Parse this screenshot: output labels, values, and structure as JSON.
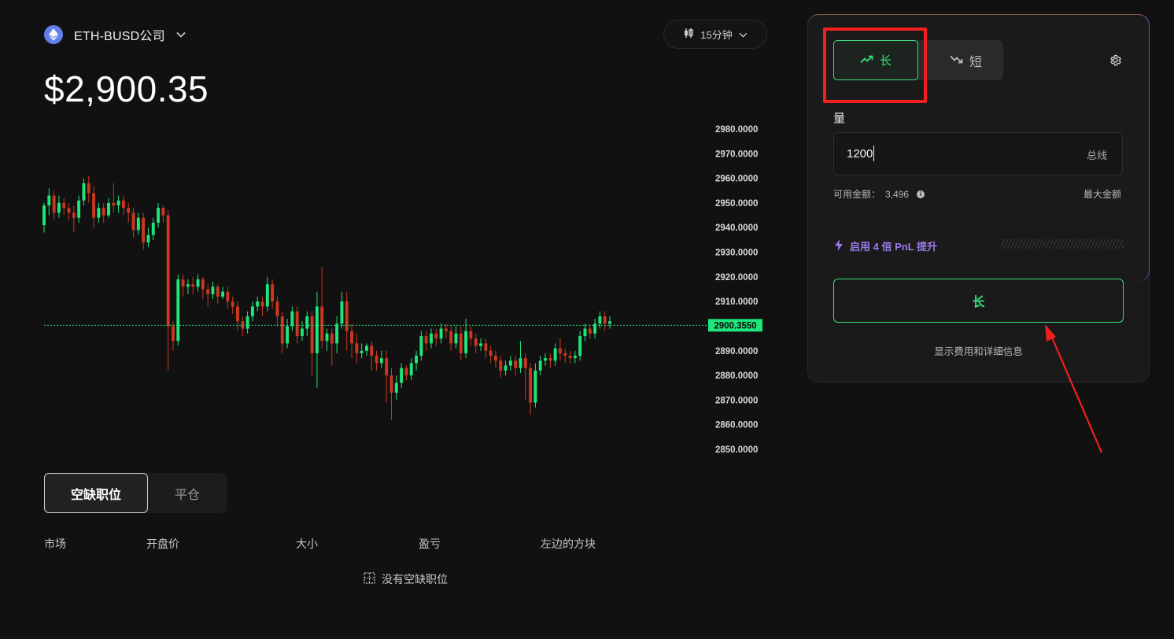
{
  "header": {
    "pair": "ETH-BUSD公司",
    "pair_icon": "ethereum-icon",
    "price": "$2,900.35",
    "interval": "15分钟"
  },
  "chart_data": {
    "type": "candlestick",
    "ylim": [
      2850,
      2980
    ],
    "y_ticks": [
      "2980.0000",
      "2970.0000",
      "2960.0000",
      "2950.0000",
      "2940.0000",
      "2930.0000",
      "2920.0000",
      "2910.0000",
      "2900.0000",
      "2890.0000",
      "2880.0000",
      "2870.0000",
      "2860.0000",
      "2850.0000"
    ],
    "current_price_label": "2900.3550",
    "current_price": 2900.355,
    "colors": {
      "up": "#1fe57a",
      "down": "#c8391f",
      "price_line": "#1fe57a"
    },
    "candles": [
      [
        2941,
        2949,
        2938,
        2950
      ],
      [
        2949,
        2953,
        2945,
        2956
      ],
      [
        2953,
        2946,
        2943,
        2955
      ],
      [
        2946,
        2950,
        2944,
        2953
      ],
      [
        2950,
        2948,
        2945,
        2952
      ],
      [
        2948,
        2946,
        2943,
        2950
      ],
      [
        2946,
        2944,
        2938,
        2949
      ],
      [
        2944,
        2951,
        2942,
        2953
      ],
      [
        2951,
        2958,
        2949,
        2960
      ],
      [
        2958,
        2954,
        2950,
        2961
      ],
      [
        2954,
        2944,
        2940,
        2957
      ],
      [
        2944,
        2948,
        2942,
        2950
      ],
      [
        2948,
        2945,
        2942,
        2950
      ],
      [
        2945,
        2950,
        2944,
        2952
      ],
      [
        2950,
        2949,
        2946,
        2958
      ],
      [
        2949,
        2951,
        2946,
        2953
      ],
      [
        2951,
        2948,
        2945,
        2953
      ],
      [
        2948,
        2946,
        2942,
        2950
      ],
      [
        2946,
        2939,
        2936,
        2948
      ],
      [
        2939,
        2944,
        2937,
        2946
      ],
      [
        2944,
        2934,
        2931,
        2946
      ],
      [
        2934,
        2937,
        2932,
        2940
      ],
      [
        2937,
        2942,
        2935,
        2944
      ],
      [
        2942,
        2948,
        2940,
        2950
      ],
      [
        2948,
        2945,
        2942,
        2949
      ],
      [
        2945,
        2900,
        2882,
        2947
      ],
      [
        2900,
        2894,
        2890,
        2902
      ],
      [
        2894,
        2919,
        2892,
        2921
      ],
      [
        2919,
        2916,
        2912,
        2921
      ],
      [
        2916,
        2917,
        2913,
        2919
      ],
      [
        2917,
        2916,
        2913,
        2920
      ],
      [
        2916,
        2919,
        2914,
        2921
      ],
      [
        2919,
        2915,
        2911,
        2920
      ],
      [
        2915,
        2913,
        2908,
        2917
      ],
      [
        2913,
        2916,
        2911,
        2918
      ],
      [
        2916,
        2912,
        2909,
        2917
      ],
      [
        2912,
        2914,
        2911,
        2916
      ],
      [
        2914,
        2910,
        2907,
        2916
      ],
      [
        2910,
        2908,
        2905,
        2912
      ],
      [
        2908,
        2902,
        2898,
        2910
      ],
      [
        2902,
        2899,
        2896,
        2904
      ],
      [
        2899,
        2904,
        2897,
        2906
      ],
      [
        2904,
        2908,
        2902,
        2910
      ],
      [
        2908,
        2910,
        2906,
        2912
      ],
      [
        2910,
        2908,
        2904,
        2912
      ],
      [
        2908,
        2917,
        2906,
        2920
      ],
      [
        2917,
        2910,
        2907,
        2919
      ],
      [
        2910,
        2904,
        2900,
        2912
      ],
      [
        2904,
        2893,
        2889,
        2906
      ],
      [
        2893,
        2900,
        2891,
        2903
      ],
      [
        2900,
        2906,
        2898,
        2908
      ],
      [
        2906,
        2896,
        2893,
        2908
      ],
      [
        2896,
        2899,
        2894,
        2902
      ],
      [
        2899,
        2904,
        2896,
        2906
      ],
      [
        2904,
        2889,
        2880,
        2906
      ],
      [
        2889,
        2908,
        2875,
        2914
      ],
      [
        2908,
        2894,
        2891,
        2924
      ],
      [
        2894,
        2897,
        2890,
        2899
      ],
      [
        2897,
        2893,
        2884,
        2899
      ],
      [
        2893,
        2901,
        2889,
        2904
      ],
      [
        2901,
        2910,
        2899,
        2914
      ],
      [
        2910,
        2898,
        2890,
        2914
      ],
      [
        2898,
        2893,
        2887,
        2901
      ],
      [
        2893,
        2889,
        2885,
        2897
      ],
      [
        2889,
        2890,
        2887,
        2893
      ],
      [
        2890,
        2892,
        2888,
        2893
      ],
      [
        2892,
        2888,
        2882,
        2894
      ],
      [
        2888,
        2885,
        2882,
        2890
      ],
      [
        2885,
        2887,
        2883,
        2890
      ],
      [
        2887,
        2880,
        2869,
        2890
      ],
      [
        2880,
        2873,
        2862,
        2883
      ],
      [
        2873,
        2877,
        2870,
        2880
      ],
      [
        2877,
        2883,
        2875,
        2885
      ],
      [
        2883,
        2880,
        2878,
        2884
      ],
      [
        2880,
        2885,
        2878,
        2887
      ],
      [
        2885,
        2888,
        2882,
        2890
      ],
      [
        2888,
        2896,
        2886,
        2898
      ],
      [
        2896,
        2893,
        2890,
        2898
      ],
      [
        2893,
        2897,
        2891,
        2899
      ],
      [
        2897,
        2895,
        2892,
        2899
      ],
      [
        2895,
        2899,
        2893,
        2901
      ],
      [
        2899,
        2898,
        2895,
        2901
      ],
      [
        2898,
        2893,
        2890,
        2900
      ],
      [
        2893,
        2897,
        2891,
        2900
      ],
      [
        2897,
        2889,
        2886,
        2900
      ],
      [
        2889,
        2898,
        2887,
        2903
      ],
      [
        2898,
        2895,
        2892,
        2900
      ],
      [
        2895,
        2892,
        2889,
        2897
      ],
      [
        2892,
        2893,
        2890,
        2895
      ],
      [
        2893,
        2890,
        2887,
        2895
      ],
      [
        2890,
        2888,
        2885,
        2892
      ],
      [
        2888,
        2886,
        2883,
        2890
      ],
      [
        2886,
        2882,
        2879,
        2888
      ],
      [
        2882,
        2884,
        2880,
        2886
      ],
      [
        2884,
        2886,
        2882,
        2888
      ],
      [
        2886,
        2883,
        2880,
        2888
      ],
      [
        2883,
        2887,
        2881,
        2894
      ],
      [
        2887,
        2883,
        2870,
        2889
      ],
      [
        2883,
        2869,
        2864,
        2885
      ],
      [
        2869,
        2882,
        2867,
        2885
      ],
      [
        2882,
        2886,
        2880,
        2888
      ],
      [
        2886,
        2887,
        2884,
        2889
      ],
      [
        2887,
        2886,
        2883,
        2889
      ],
      [
        2886,
        2891,
        2884,
        2893
      ],
      [
        2891,
        2889,
        2886,
        2895
      ],
      [
        2889,
        2888,
        2885,
        2891
      ],
      [
        2888,
        2887,
        2885,
        2890
      ],
      [
        2887,
        2888,
        2885,
        2890
      ],
      [
        2888,
        2896,
        2886,
        2898
      ],
      [
        2896,
        2899,
        2894,
        2901
      ],
      [
        2899,
        2897,
        2895,
        2901
      ],
      [
        2897,
        2901,
        2895,
        2903
      ],
      [
        2901,
        2904,
        2899,
        2906
      ],
      [
        2904,
        2901,
        2898,
        2906
      ],
      [
        2901,
        2902,
        2899,
        2904
      ]
    ]
  },
  "positions": {
    "tabs": [
      "空缺职位",
      "平仓"
    ],
    "columns": [
      "市场",
      "开盘价",
      "大小",
      "盈亏",
      "左边的方块"
    ],
    "empty": "没有空缺职位"
  },
  "order_panel": {
    "long_label": "长",
    "short_label": "短",
    "qty_label": "量",
    "qty_value": "1200",
    "qty_unit": "总线",
    "available_label": "可用金额：",
    "available_value": "3,496",
    "max_label": "最大金额",
    "boost_label": "启用 4 倍 PnL 提升",
    "submit_label": "长",
    "details_label": "显示费用和详细信息",
    "accent": "#38e07a",
    "boost_color": "#9b7bea",
    "annotation_color": "#f21f1f"
  }
}
